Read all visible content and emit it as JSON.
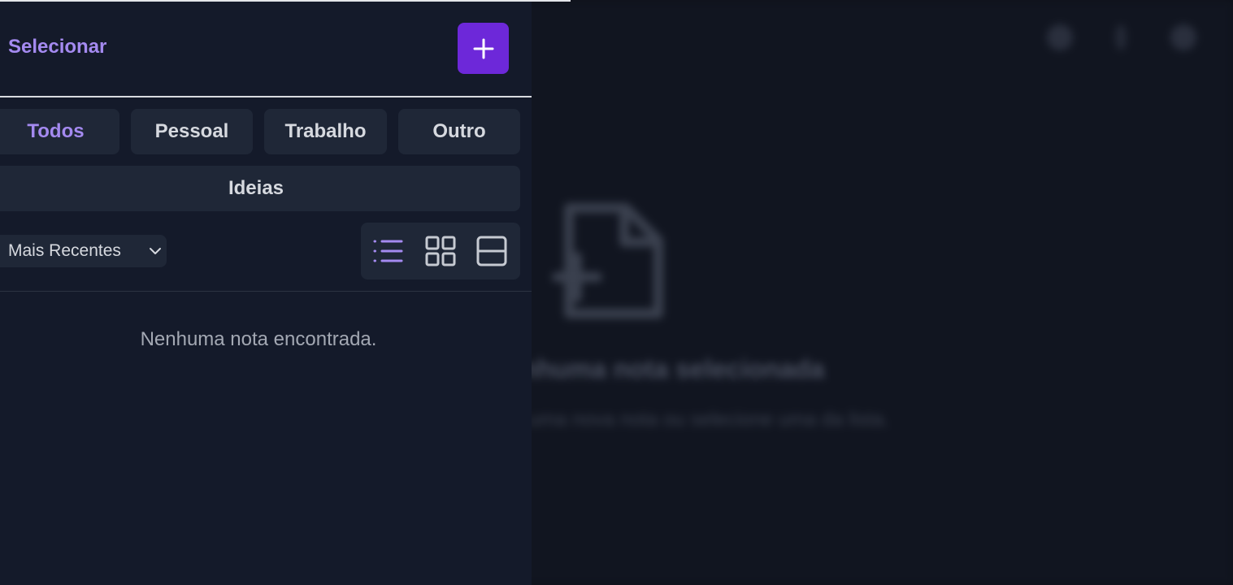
{
  "header": {
    "select_label": "Selecionar",
    "new_note_icon": "plus-icon"
  },
  "categories": [
    {
      "label": "Todos",
      "active": true
    },
    {
      "label": "Pessoal",
      "active": false
    },
    {
      "label": "Trabalho",
      "active": false
    },
    {
      "label": "Outro",
      "active": false
    },
    {
      "label": "Ideias",
      "active": false
    }
  ],
  "sort": {
    "selected": "Mais Recentes"
  },
  "view_modes": {
    "active": "list",
    "options": [
      "list",
      "grid",
      "compact"
    ]
  },
  "notes_list": {
    "empty_message": "Nenhuma nota encontrada."
  },
  "main_panel": {
    "empty_title": "Nenhuma nota selecionada",
    "empty_subtitle": "Crie uma nova nota ou selecione uma da lista."
  },
  "colors": {
    "accent": "#6d28d9",
    "accent_text": "#a48af0",
    "sidebar_bg": "#141a2a",
    "button_bg": "#1f2737"
  }
}
